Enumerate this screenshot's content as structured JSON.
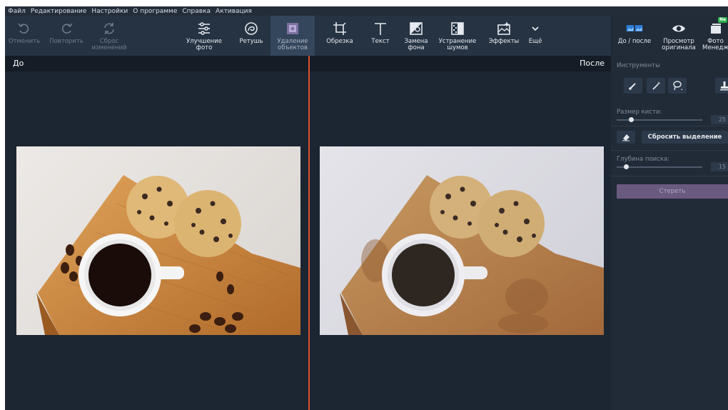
{
  "menu": [
    "Файл",
    "Редактирование",
    "Настройки",
    "О программе",
    "Справка",
    "Активация"
  ],
  "toolbar": {
    "undo": "Отменить",
    "redo": "Повторить",
    "reset": "Сброс\nизменений",
    "enhance": "Улучшение\nфото",
    "retouch": "Ретушь",
    "remove_objects": "Удаление\nобъектов",
    "crop": "Обрезка",
    "text": "Текст",
    "bg_replace": "Замена\nфона",
    "denoise": "Устранение\nшумов",
    "effects": "Эффекты",
    "more": "Ещё",
    "before_after": "До / после",
    "view_original": "Просмотр\nоригинала",
    "photo_manager": "Фото\nМенедж",
    "new_badge": "Ne"
  },
  "view": {
    "before": "До",
    "after": "После"
  },
  "panel": {
    "tools_title": "Инструменты",
    "brush_size_label": "Размер кисти:",
    "brush_size_value": "25",
    "reset_selection": "Сбросить выделение",
    "search_depth_label": "Глубина поиска:",
    "search_depth_value": "15",
    "erase": "Стереть",
    "brush_size_level": 0.14,
    "search_depth_level": 0.08
  },
  "colors": {
    "accent_line": "#d8512c",
    "erase_button": "#6a5a80",
    "active_tool": "#34465c"
  }
}
